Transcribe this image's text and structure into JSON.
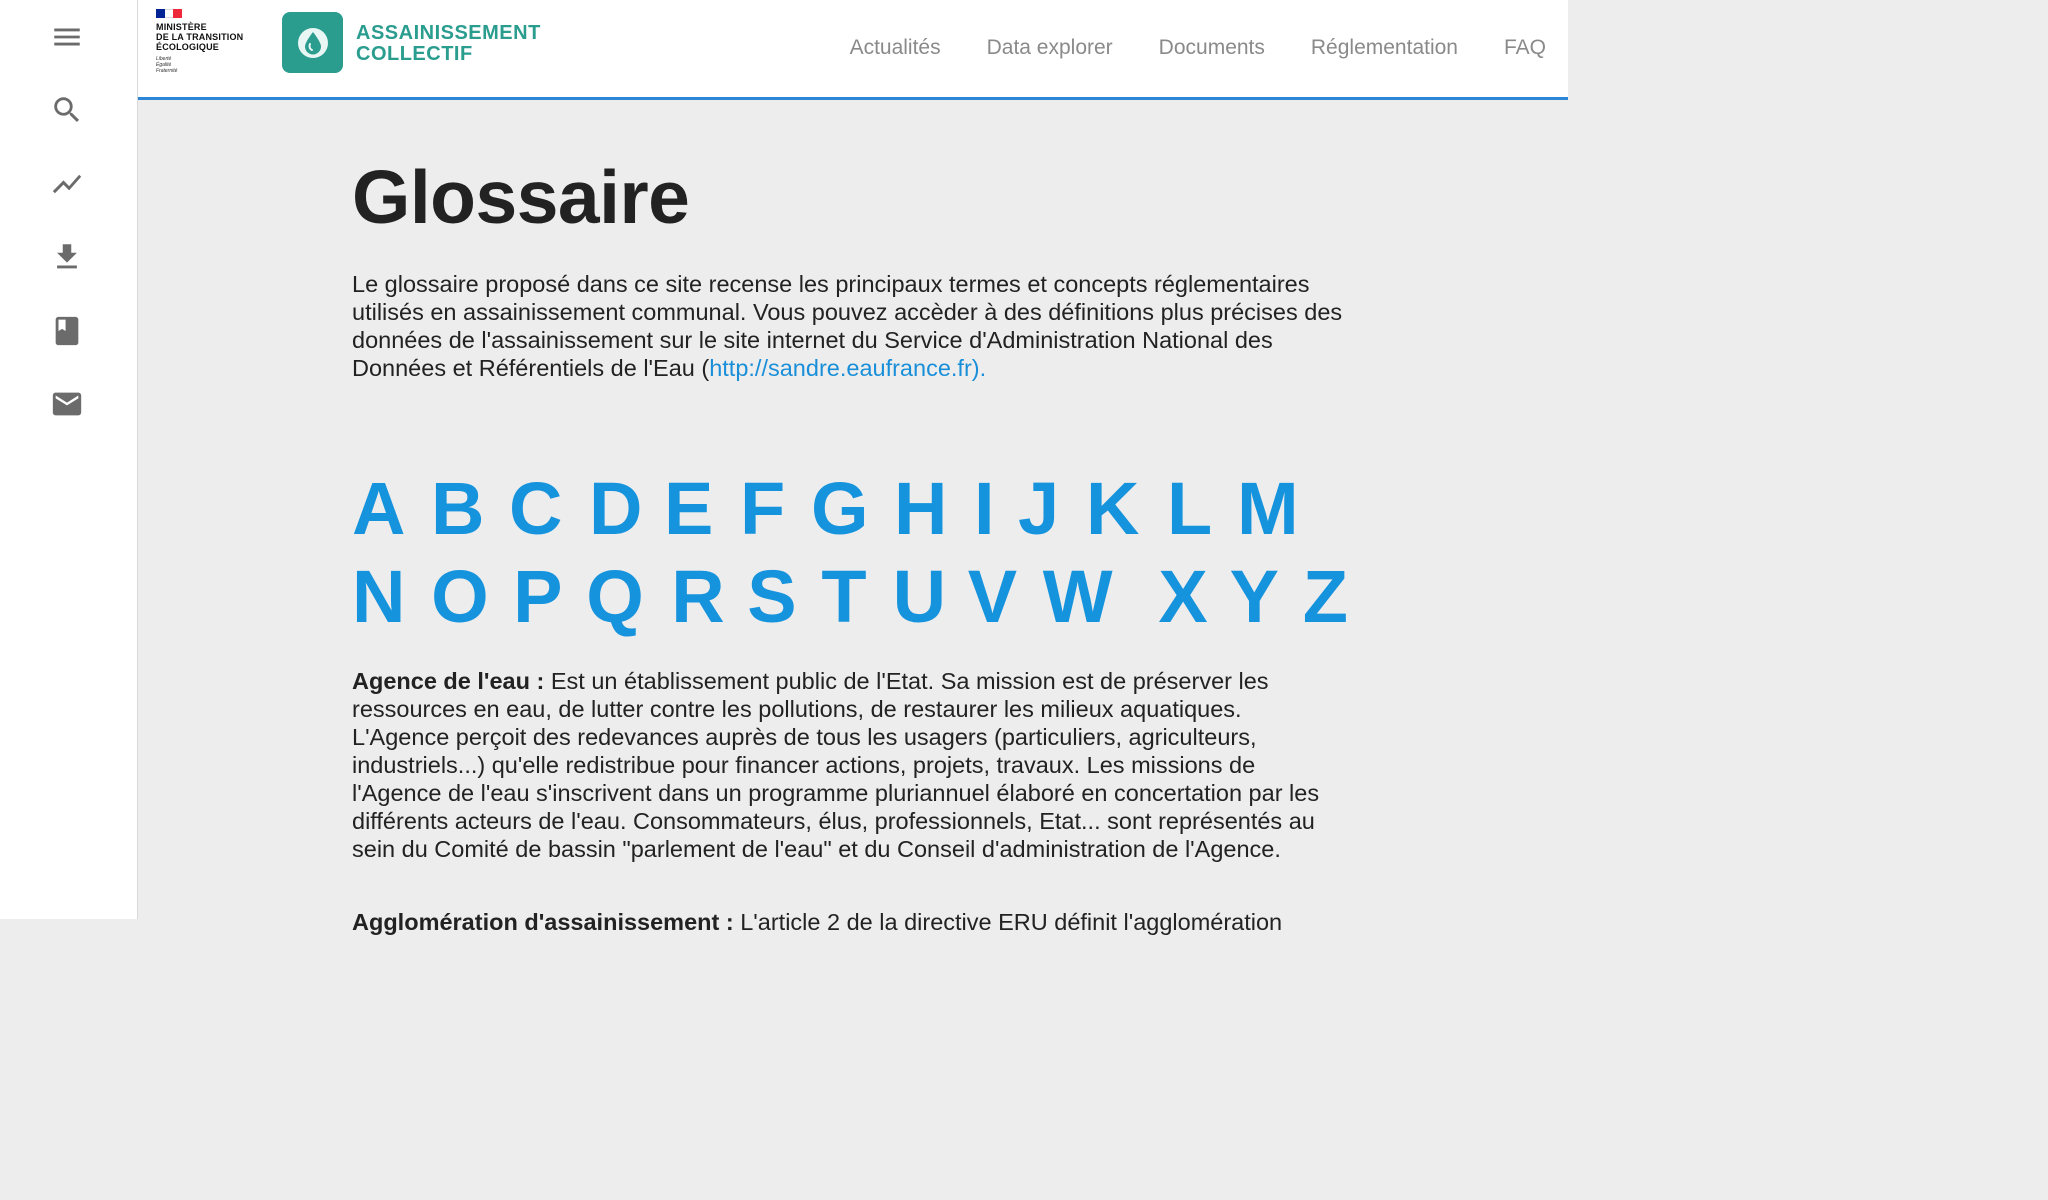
{
  "sidebar": {
    "items": [
      {
        "icon": "menu-icon"
      },
      {
        "icon": "search-icon"
      },
      {
        "icon": "trending-chart-icon"
      },
      {
        "icon": "download-icon"
      },
      {
        "icon": "book-icon"
      },
      {
        "icon": "mail-icon"
      }
    ],
    "icon_color": "#6b6b6b"
  },
  "header": {
    "ministry_lines": [
      "MINISTÈRE",
      "DE LA TRANSITION",
      "ÉCOLOGIQUE"
    ],
    "motto_lines": [
      "Liberté",
      "Égalité",
      "Fraternité"
    ],
    "app_title_line1": "ASSAINISSEMENT",
    "app_title_line2": "COLLECTIF",
    "brand_color": "#2a9d8f",
    "accent_border_color": "#2b87d6",
    "nav": [
      {
        "label": "Actualités"
      },
      {
        "label": "Data explorer"
      },
      {
        "label": "Documents"
      },
      {
        "label": "Réglementation"
      },
      {
        "label": "FAQ"
      }
    ]
  },
  "main": {
    "title": "Glossaire",
    "intro_text": "Le glossaire proposé dans ce site recense les principaux termes et concepts réglementaires utilisés en assainissement communal. Vous pouvez accèder à des définitions plus précises des données de l'assainissement sur le site internet du Service d'Administration National des Données et Référentiels de l'Eau (",
    "intro_link": "http://sandre.eaufrance.fr).",
    "link_color": "#1693dd",
    "letters_row1": [
      "A",
      "B",
      "C",
      "D",
      "E",
      "F",
      "G",
      "H",
      "I",
      "J",
      "K",
      "L",
      "M"
    ],
    "letters_row2": [
      "N",
      "O",
      "P",
      "Q",
      "R",
      "S",
      "T",
      "U",
      "V",
      "W",
      "X",
      "Y",
      "Z"
    ],
    "entries": [
      {
        "term": "Agence de l'eau :",
        "definition": " Est un établissement public de l'Etat. Sa mission est de préserver les ressources en eau, de lutter contre les pollutions, de restaurer les milieux aquatiques. L'Agence perçoit des redevances auprès de tous les usagers (particuliers, agriculteurs, industriels...) qu'elle redistribue pour financer actions, projets, travaux. Les missions de l'Agence de l'eau s'inscrivent dans un programme pluriannuel élaboré en concertation par les différents acteurs de l'eau. Consommateurs, élus, professionnels, Etat... sont représentés au sein du Comité de bassin \"parlement de l'eau\" et du Conseil d'administration de l'Agence."
      },
      {
        "term": "Agglomération d'assainissement :",
        "definition": " L'article 2 de la directive ERU définit l'agglomération"
      }
    ]
  }
}
